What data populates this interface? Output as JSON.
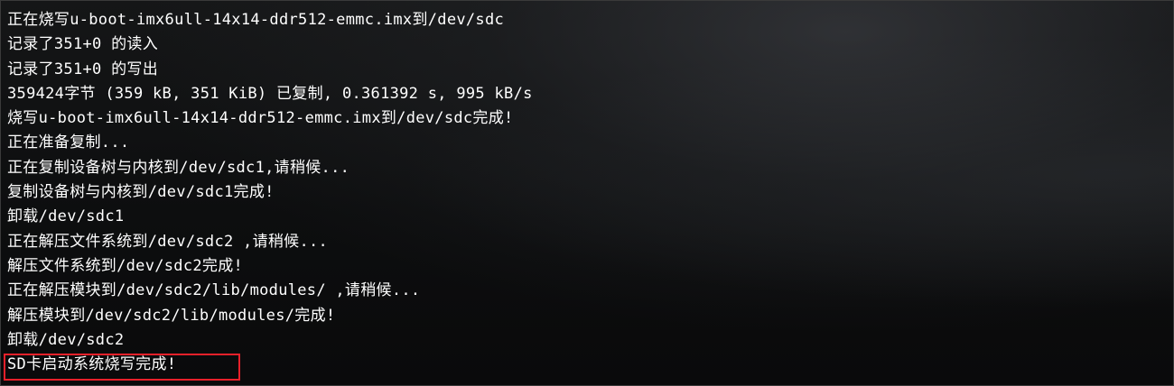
{
  "terminal": {
    "lines": [
      "正在烧写u-boot-imx6ull-14x14-ddr512-emmc.imx到/dev/sdc",
      "记录了351+0 的读入",
      "记录了351+0 的写出",
      "359424字节 (359 kB, 351 KiB) 已复制, 0.361392 s, 995 kB/s",
      "烧写u-boot-imx6ull-14x14-ddr512-emmc.imx到/dev/sdc完成!",
      "正在准备复制...",
      "正在复制设备树与内核到/dev/sdc1,请稍候...",
      "复制设备树与内核到/dev/sdc1完成!",
      "卸载/dev/sdc1",
      "正在解压文件系统到/dev/sdc2 ,请稍候...",
      "解压文件系统到/dev/sdc2完成!",
      "正在解压模块到/dev/sdc2/lib/modules/ ,请稍候...",
      "解压模块到/dev/sdc2/lib/modules/完成!",
      "卸载/dev/sdc2",
      "SD卡启动系统烧写完成!"
    ],
    "highlight_color": "#e8202a",
    "text_color": "#ffffff"
  }
}
